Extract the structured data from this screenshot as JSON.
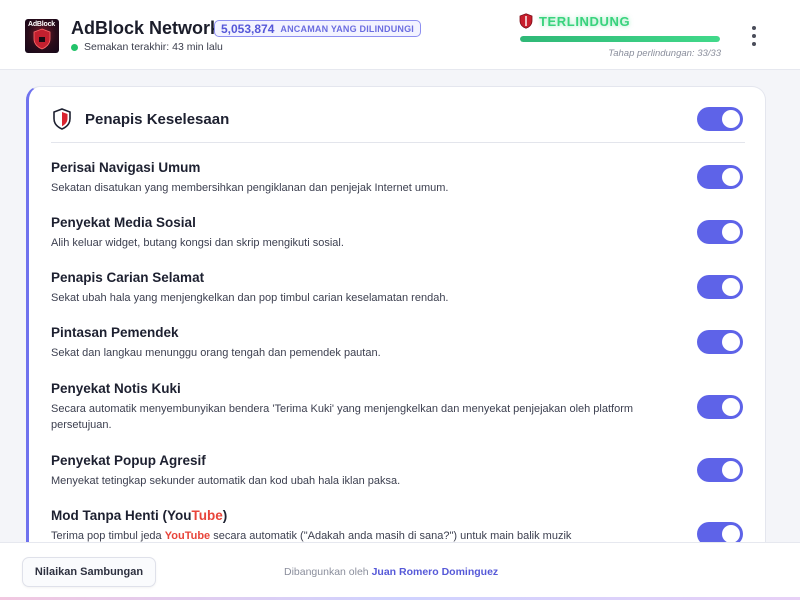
{
  "header": {
    "logo_text": "AdBlock",
    "app_title": "AdBlock Network",
    "threat_count": "5,053,874",
    "threat_label": "ANCAMAN YANG DILINDUNGI",
    "last_check": "Semakan terakhir: 43 min lalu",
    "status": "TERLINDUNG",
    "protection_level_text": "Tahap perlindungan: 33/33",
    "protection_progress": 1.0,
    "status_color": "#39d37d",
    "menu_icon": "more-vertical-icon"
  },
  "card": {
    "title": "Penapis Keselesaan",
    "icon": "shield-icon",
    "enabled": true,
    "accent_color": "#5e63e8",
    "filters": [
      {
        "title": "Perisai Navigasi Umum",
        "description": "Sekatan disatukan yang membersihkan pengiklanan dan penjejak Internet umum.",
        "enabled": true
      },
      {
        "title": "Penyekat Media Sosial",
        "description": "Alih keluar widget, butang kongsi dan skrip mengikuti sosial.",
        "enabled": true
      },
      {
        "title": "Penapis Carian Selamat",
        "description": "Sekat ubah hala yang menjengkelkan dan pop timbul carian keselamatan rendah.",
        "enabled": true
      },
      {
        "title": "Pintasan Pemendek",
        "description": "Sekat dan langkau menunggu orang tengah dan pemendek pautan.",
        "enabled": true
      },
      {
        "title": "Penyekat Notis Kuki",
        "description": "Secara automatik menyembunyikan bendera 'Terima Kuki' yang menjengkelkan dan menyekat penjejakan oleh platform persetujuan.",
        "enabled": true
      },
      {
        "title": "Penyekat Popup Agresif",
        "description": "Menyekat tetingkap sekunder automatik dan kod ubah hala iklan paksa.",
        "enabled": true
      },
      {
        "title_prefix": "Mod Tanpa Henti (",
        "title_brand_you": "You",
        "title_brand_tube": "Tube",
        "title_suffix": ")",
        "desc_prefix": "Terima pop timbul jeda ",
        "desc_brand_you": "You",
        "desc_brand_tube": "Tube",
        "desc_suffix": " secara automatik (\"Adakah anda masih di sana?\") untuk main balik muzik",
        "enabled": true
      }
    ]
  },
  "footer": {
    "rate_button": "Nilaikan Sambungan",
    "credit_prefix": "Dibangunkan oleh",
    "credit_author": "Juan Romero Dominguez"
  }
}
